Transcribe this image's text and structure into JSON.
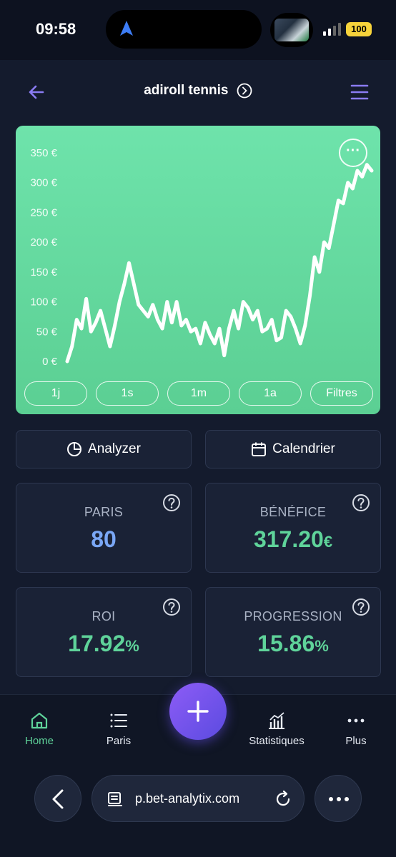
{
  "status": {
    "time": "09:58",
    "battery": "100"
  },
  "header": {
    "title": "adiroll tennis"
  },
  "chart_data": {
    "type": "line",
    "ylabels": [
      "350 €",
      "300 €",
      "250 €",
      "200 €",
      "150 €",
      "100 €",
      "50 €",
      "0 €"
    ],
    "yticks": [
      350,
      300,
      250,
      200,
      150,
      100,
      50,
      0
    ],
    "ylim": [
      0,
      350
    ],
    "series": [
      {
        "values": [
          0,
          25,
          70,
          55,
          105,
          50,
          65,
          85,
          55,
          25,
          60,
          100,
          130,
          165,
          130,
          95,
          85,
          75,
          95,
          70,
          55,
          100,
          65,
          100,
          60,
          70,
          50,
          55,
          30,
          65,
          45,
          30,
          55,
          10,
          55,
          85,
          55,
          100,
          90,
          70,
          85,
          50,
          55,
          70,
          35,
          40,
          85,
          75,
          55,
          30,
          60,
          110,
          175,
          150,
          200,
          190,
          230,
          270,
          265,
          300,
          290,
          320,
          310,
          330,
          320
        ]
      }
    ],
    "grid": false
  },
  "chart": {
    "more_label": "···",
    "ranges": [
      "1j",
      "1s",
      "1m",
      "1a",
      "Filtres"
    ]
  },
  "actions": {
    "analyzer": "Analyzer",
    "calendar": "Calendrier"
  },
  "stats": {
    "paris": {
      "label": "PARIS",
      "value": "80"
    },
    "benefice": {
      "label": "BÉNÉFICE",
      "value": "317.20",
      "unit": "€"
    },
    "roi": {
      "label": "ROI",
      "value": "17.92",
      "unit": "%"
    },
    "progression": {
      "label": "PROGRESSION",
      "value": "15.86",
      "unit": "%"
    }
  },
  "nav": {
    "home": "Home",
    "paris": "Paris",
    "statistiques": "Statistiques",
    "plus": "Plus"
  },
  "browser": {
    "url": "p.bet-analytix.com"
  },
  "colors": {
    "accent_green": "#5fd39a",
    "accent_blue": "#7aa7f5",
    "fab": "#7a55f0",
    "card": "#1a2236"
  }
}
